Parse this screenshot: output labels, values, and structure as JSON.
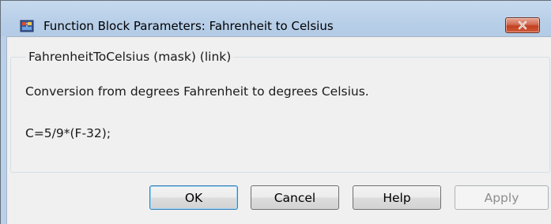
{
  "window": {
    "title": "Function Block Parameters: Fahrenheit to Celsius",
    "icon": "simulink-block-icon",
    "close_icon": "close-icon"
  },
  "group": {
    "legend": "FahrenheitToCelsius (mask) (link)",
    "description": "Conversion from degrees Fahrenheit to degrees Celsius.",
    "formula": "C=5/9*(F-32);"
  },
  "buttons": {
    "ok": "OK",
    "cancel": "Cancel",
    "help": "Help",
    "apply": "Apply"
  },
  "colors": {
    "title_bar": "#b9d1ea",
    "close_button": "#c7462a",
    "dialog_bg": "#f0f0f0",
    "default_button_border": "#3c7fb1"
  }
}
